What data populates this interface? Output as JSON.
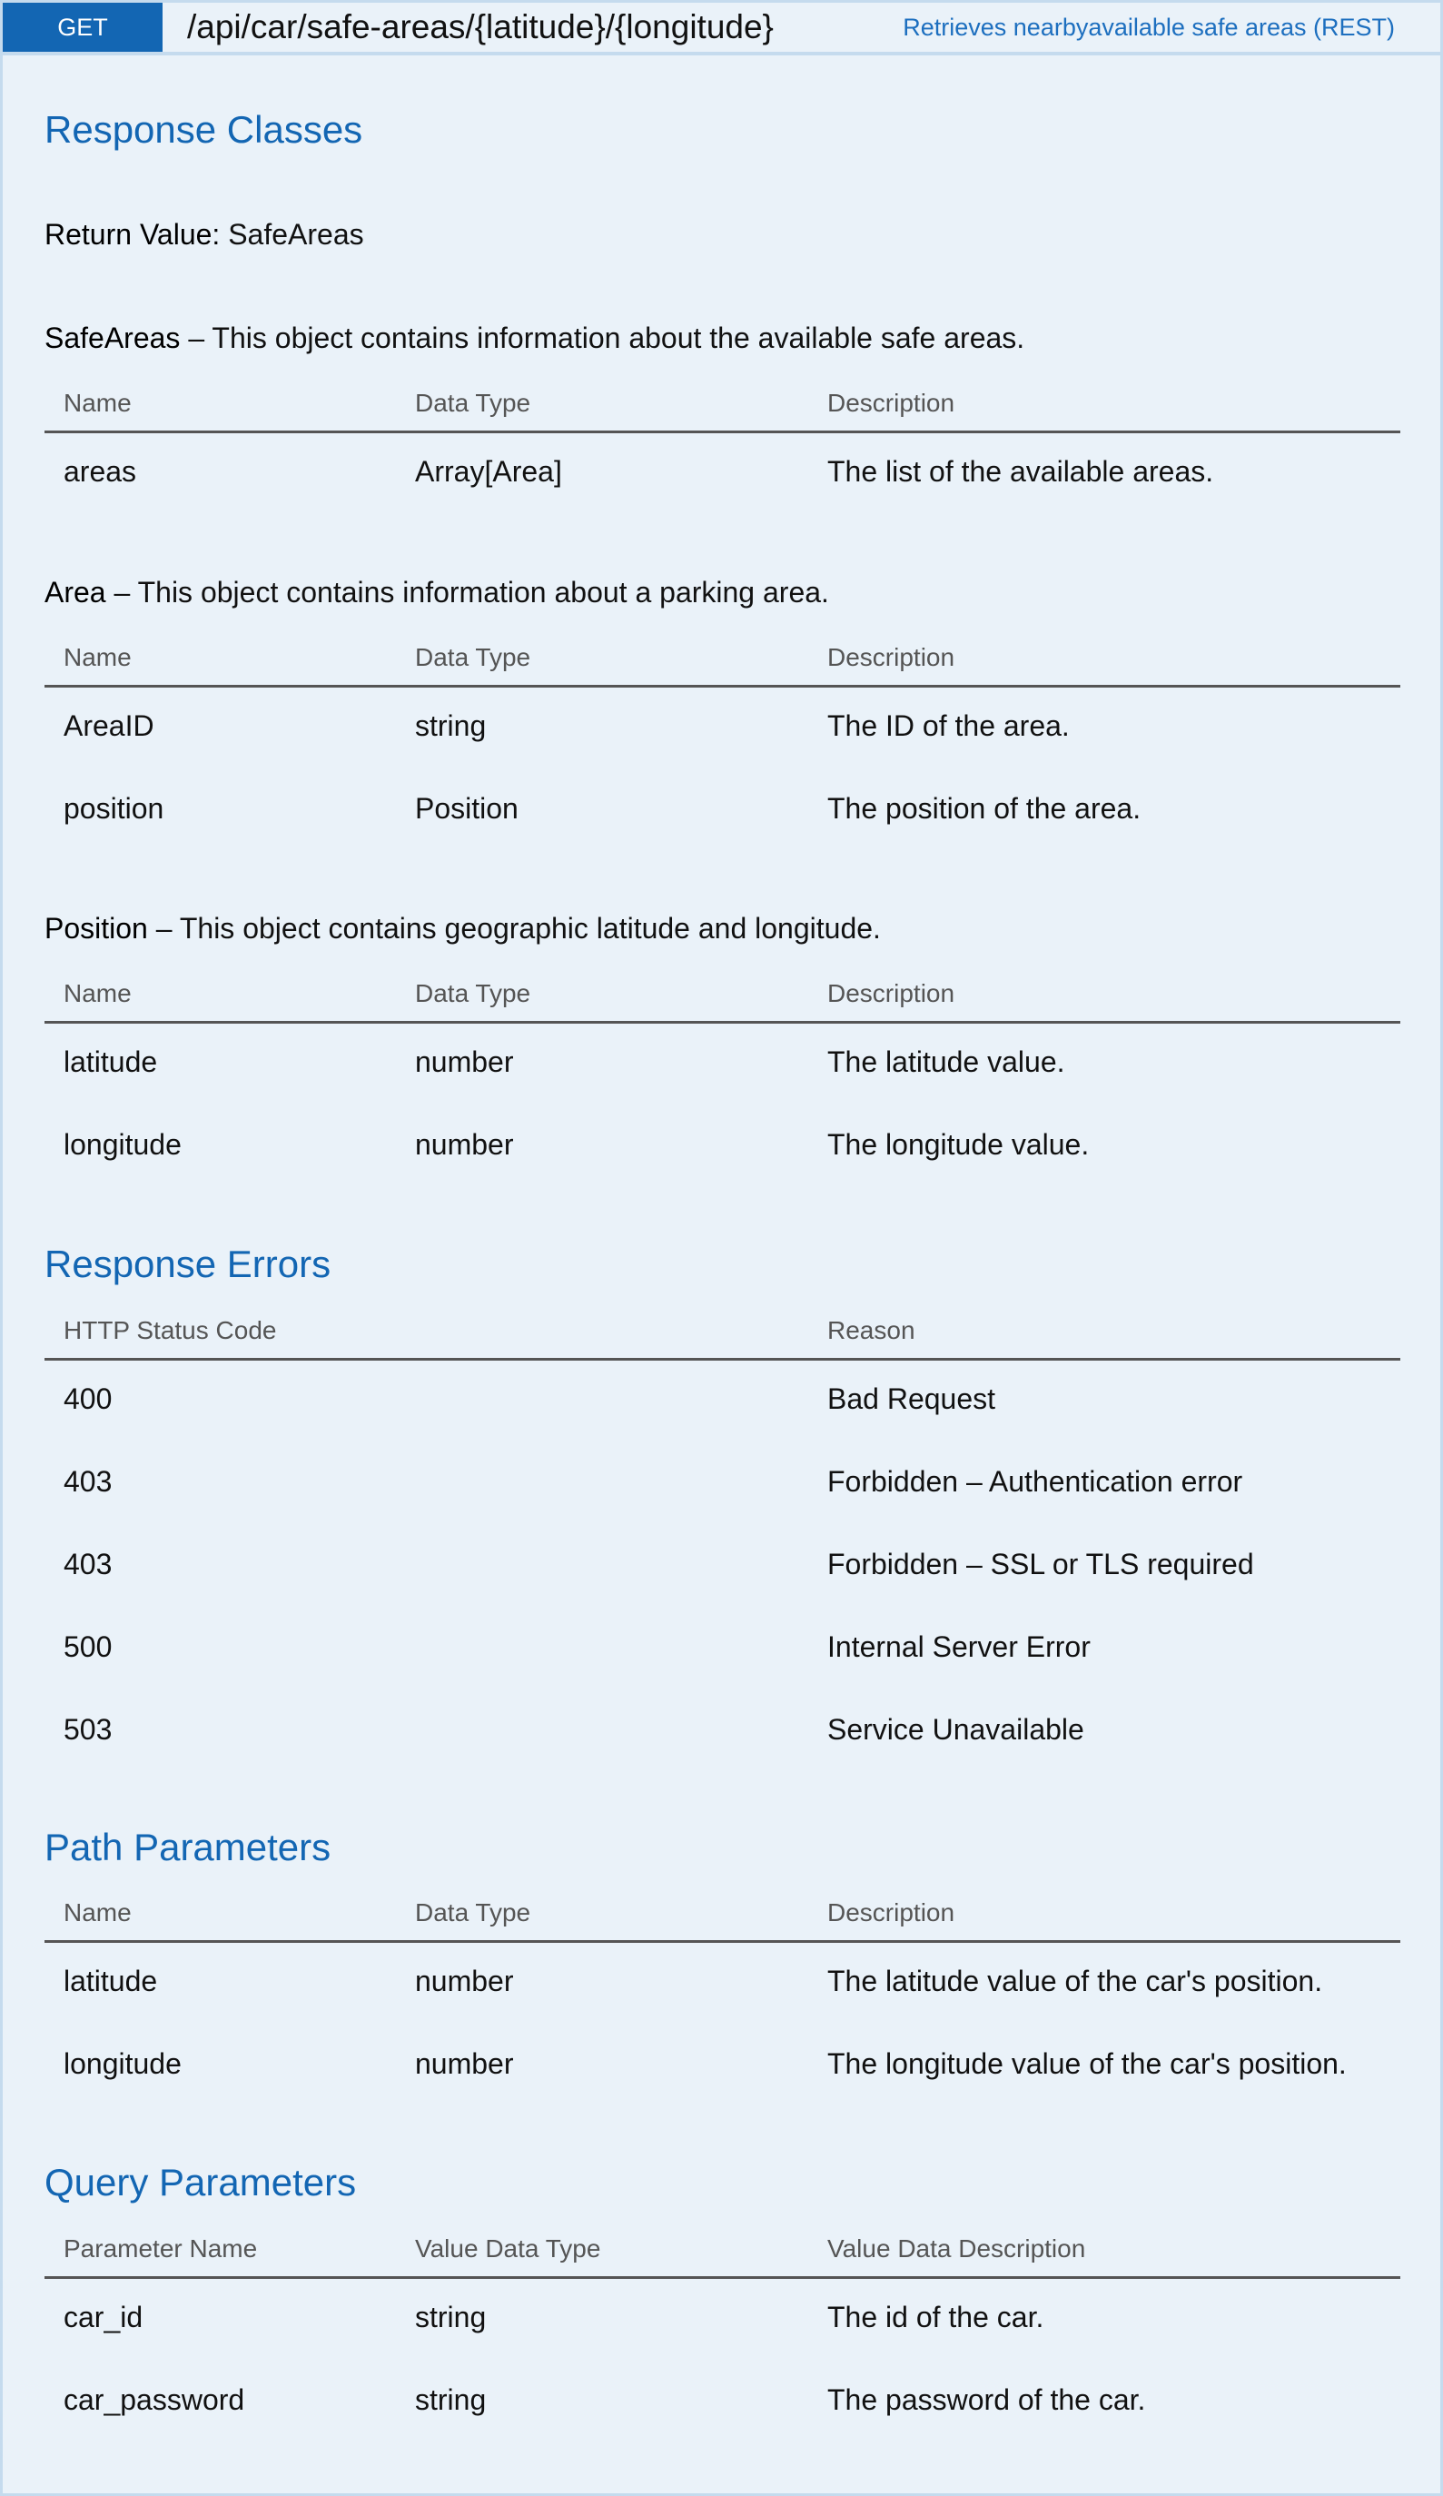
{
  "header": {
    "method": "GET",
    "path": "/api/car/safe-areas/{latitude}/{longitude}",
    "summary": "Retrieves nearbyavailable safe areas (REST)"
  },
  "response_classes": {
    "title": "Response Classes",
    "return_label": "Return Value:",
    "return_value": "SafeAreas",
    "objects": [
      {
        "name": "SafeAreas",
        "desc": " – This object contains information about the available safe areas.",
        "columns": [
          "Name",
          "Data Type",
          "Description"
        ],
        "rows": [
          [
            "areas",
            "Array[Area]",
            "The list of the available areas."
          ]
        ]
      },
      {
        "name": "Area",
        "desc": " – This object contains information about a parking area.",
        "columns": [
          "Name",
          "Data Type",
          "Description"
        ],
        "rows": [
          [
            "AreaID",
            "string",
            "The ID of the area."
          ],
          [
            "position",
            "Position",
            "The position of the area."
          ]
        ]
      },
      {
        "name": "Position",
        "desc": " – This object contains geographic latitude and longitude.",
        "columns": [
          "Name",
          "Data Type",
          "Description"
        ],
        "rows": [
          [
            "latitude",
            "number",
            "The latitude value."
          ],
          [
            "longitude",
            "number",
            "The longitude value."
          ]
        ]
      }
    ]
  },
  "response_errors": {
    "title": "Response Errors",
    "columns": [
      "HTTP Status Code",
      "",
      "Reason"
    ],
    "rows": [
      [
        "400",
        "",
        "Bad Request"
      ],
      [
        "403",
        "",
        "Forbidden – Authentication error"
      ],
      [
        "403",
        "",
        "Forbidden – SSL or TLS required"
      ],
      [
        "500",
        "",
        "Internal Server Error"
      ],
      [
        "503",
        "",
        "Service Unavailable"
      ]
    ]
  },
  "path_parameters": {
    "title": "Path Parameters",
    "columns": [
      "Name",
      "Data Type",
      "Description"
    ],
    "rows": [
      [
        "latitude",
        "number",
        "The latitude value of the car's position."
      ],
      [
        "longitude",
        "number",
        "The longitude value of the car's position."
      ]
    ]
  },
  "query_parameters": {
    "title": "Query Parameters",
    "columns": [
      "Parameter Name",
      "Value Data Type",
      "Value Data Description"
    ],
    "rows": [
      [
        "car_id",
        "string",
        "The id of the car."
      ],
      [
        "car_password",
        "string",
        "The password of the car."
      ]
    ]
  }
}
